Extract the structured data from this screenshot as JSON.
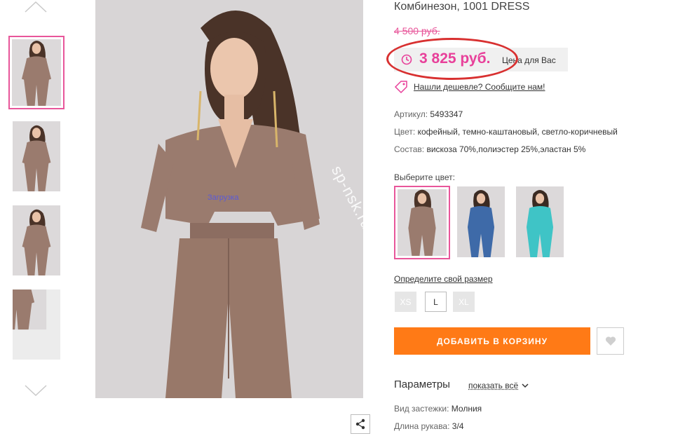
{
  "product": {
    "title": "Комбинезон, 1001 DRESS",
    "old_price": "4 500 руб.",
    "price": "3 825 руб.",
    "price_note": "Цена для Вас",
    "cheaper_link": "Нашли дешевле? Сообщите нам!"
  },
  "attributes": [
    {
      "key": "Артикул:",
      "value": "5493347"
    },
    {
      "key": "Цвет:",
      "value": "кофейный, темно-каштановый, светло-коричневый"
    },
    {
      "key": "Состав:",
      "value": "вискоза 70%,полиэстер 25%,эластан 5%"
    }
  ],
  "gallery": {
    "loading_text": "Загрузка",
    "watermark": "sp-nsk.ru"
  },
  "colors": {
    "label": "Выберите цвет:",
    "options": [
      {
        "name": "coffee",
        "color": "#9a7b6e",
        "selected": true
      },
      {
        "name": "blue",
        "color": "#3e6aa8",
        "selected": false
      },
      {
        "name": "turquoise",
        "color": "#3fc4c6",
        "selected": false
      }
    ]
  },
  "sizes": {
    "link": "Определите свой размер",
    "options": [
      {
        "label": "XS",
        "available": false
      },
      {
        "label": "L",
        "available": true
      },
      {
        "label": "XL",
        "available": false
      }
    ]
  },
  "cart": {
    "add_label": "ДОБАВИТЬ В КОРЗИНУ"
  },
  "params": {
    "title": "Параметры",
    "show_all": "показать всё",
    "items": [
      {
        "key": "Вид застежки:",
        "value": "Молния"
      },
      {
        "key": "Длина рукава:",
        "value": "3/4"
      }
    ]
  },
  "theme": {
    "accent_pink": "#e8409a",
    "accent_orange": "#ff7a16",
    "annotation_red": "#d83030"
  },
  "icons": [
    "chevron-up-icon",
    "chevron-down-icon",
    "share-icon",
    "clock-icon",
    "price-tag-icon",
    "heart-icon",
    "chevron-down-small-icon"
  ]
}
